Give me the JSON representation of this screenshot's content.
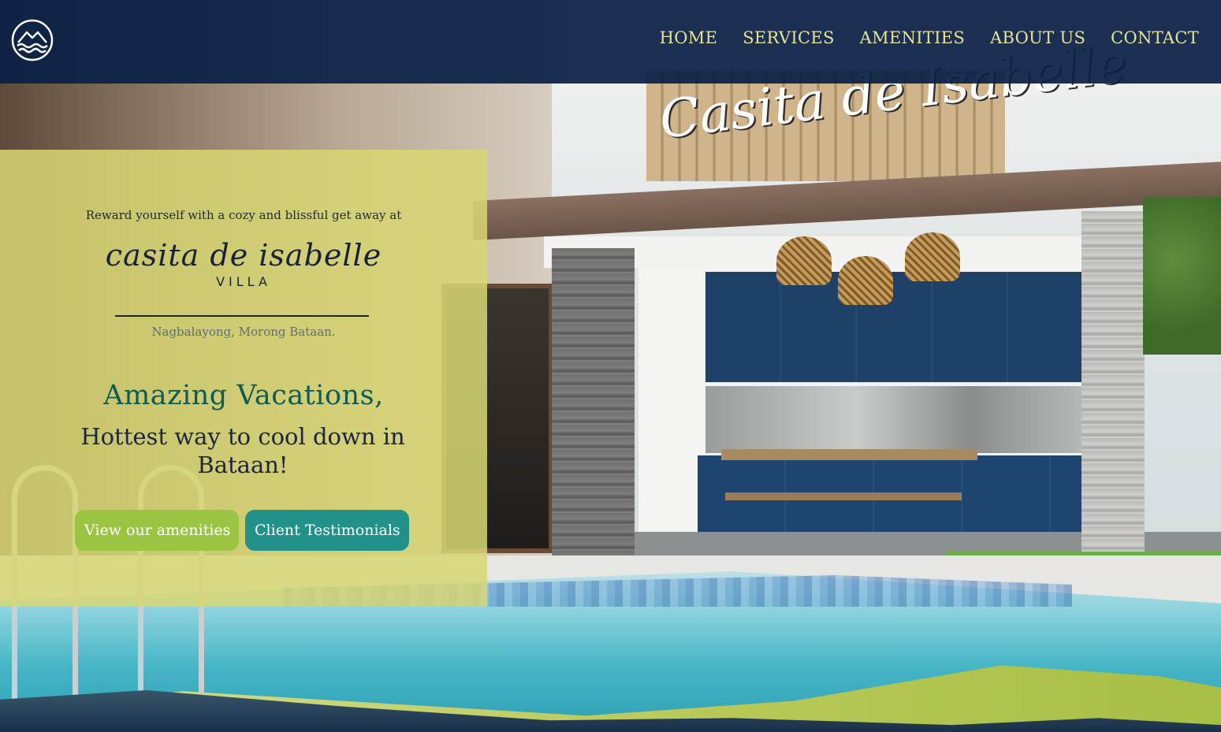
{
  "header": {
    "logo_icon": "waves-mountain-logo-icon",
    "nav": [
      {
        "label": "HOME"
      },
      {
        "label": "SERVICES"
      },
      {
        "label": "AMENITIES"
      },
      {
        "label": "ABOUT US"
      },
      {
        "label": "CONTACT"
      }
    ]
  },
  "hero": {
    "sign_text": "Casita de Isabelle"
  },
  "intro": {
    "tagline": "Reward yourself with a cozy and blissful get away at",
    "brand_name": "casita de isabelle",
    "brand_sub": "VILLA",
    "location": "Nagbalayong, Morong Bataan.",
    "headline": "Amazing Vacations,",
    "subhead": "Hottest way to cool down in Bataan!",
    "buttons": {
      "amenities": "View our amenities",
      "testimonials": "Client Testimonials"
    }
  },
  "colors": {
    "header_bg": "#0a2046",
    "nav_text": "#e7e29a",
    "card_bg": "#d7d673",
    "headline": "#0d5a57",
    "button_amenities": "#9cc443",
    "button_testimonials": "#21918a"
  }
}
